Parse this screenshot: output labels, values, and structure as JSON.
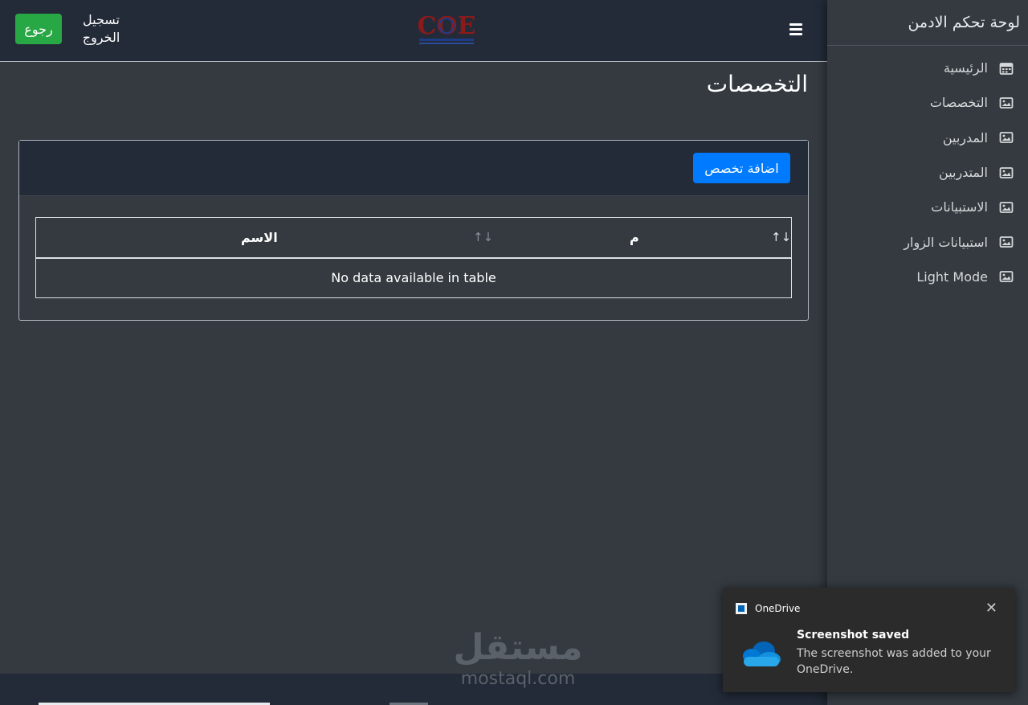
{
  "sidebar": {
    "brand": "لوحة تحكم الادمن",
    "items": [
      {
        "label": "الرئيسية",
        "icon": "calendar-icon"
      },
      {
        "label": "التخصصات",
        "icon": "image-icon"
      },
      {
        "label": "المدربين",
        "icon": "image-icon"
      },
      {
        "label": "المتدربين",
        "icon": "image-icon"
      },
      {
        "label": "الاستبيانات",
        "icon": "image-icon"
      },
      {
        "label": "استبيانات الزوار",
        "icon": "image-icon"
      },
      {
        "label": "Light Mode",
        "icon": "image-icon"
      }
    ]
  },
  "header": {
    "back_label": "رجوع",
    "logout_label": "تسجيل الخروج",
    "logo_text": "COE"
  },
  "page": {
    "title": "التخصصات"
  },
  "card": {
    "add_button_label": "اضافة تخصص"
  },
  "table": {
    "columns": [
      "م",
      "الاسم"
    ],
    "empty_text": "No data available in table"
  },
  "watermark": {
    "arabic": "مستقل",
    "latin": "mostaql.com"
  },
  "toast": {
    "app_name": "OneDrive",
    "title": "Screenshot saved",
    "body": "The screenshot was added to your OneDrive."
  },
  "colors": {
    "background": "#343a40",
    "navbar": "#232b38",
    "success": "#28a745",
    "primary": "#007bff"
  }
}
